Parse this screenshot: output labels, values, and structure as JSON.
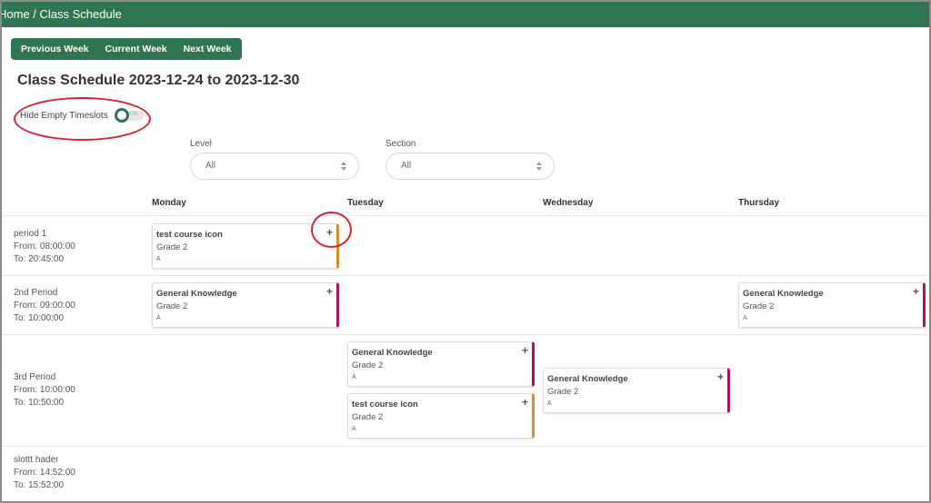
{
  "breadcrumb": "Home / Class Schedule",
  "week_nav": {
    "previous": "Previous Week",
    "current": "Current Week",
    "next": "Next Week"
  },
  "title": "Class Schedule 2023-12-24 to 2023-12-30",
  "hide_empty": {
    "label": "Hide Empty Timeslots",
    "state": "On"
  },
  "filters": {
    "level": {
      "label": "Level",
      "value": "All"
    },
    "section": {
      "label": "Section",
      "value": "All"
    }
  },
  "days": [
    "Monday",
    "Tuesday",
    "Wednesday",
    "Thursday"
  ],
  "periods": [
    {
      "name": "period 1",
      "from": "From: 08:00:00",
      "to": "To: 20:45:00"
    },
    {
      "name": "2nd Period",
      "from": "From: 09:00:00",
      "to": "To: 10:00:00"
    },
    {
      "name": "3rd Period",
      "from": "From: 10:00:00",
      "to": "To: 10:50:00"
    },
    {
      "name": "slottt hader",
      "from": "From: 14:52:00",
      "to": "To: 15:52:00"
    }
  ],
  "cards": [
    {
      "title": "test course icon",
      "grade": "Grade 2",
      "section": "A",
      "add": "+"
    },
    {
      "title": "General Knowledge",
      "grade": "Grade 2",
      "section": "A",
      "add": "+"
    },
    {
      "title": "General Knowledge",
      "grade": "Grade 2",
      "section": "A",
      "add": "+"
    },
    {
      "title": "General Knowledge",
      "grade": "Grade 2",
      "section": "A",
      "add": "+"
    },
    {
      "title": "test course icon",
      "grade": "Grade 2",
      "section": "A",
      "add": "+"
    },
    {
      "title": "General Knowledge",
      "grade": "Grade 2",
      "section": "A",
      "add": "+"
    }
  ],
  "colors": {
    "brand": "#2f7553",
    "accent_orange": "#d98a2b",
    "accent_magenta": "#b0125f",
    "annotation_red": "#d8242c"
  }
}
